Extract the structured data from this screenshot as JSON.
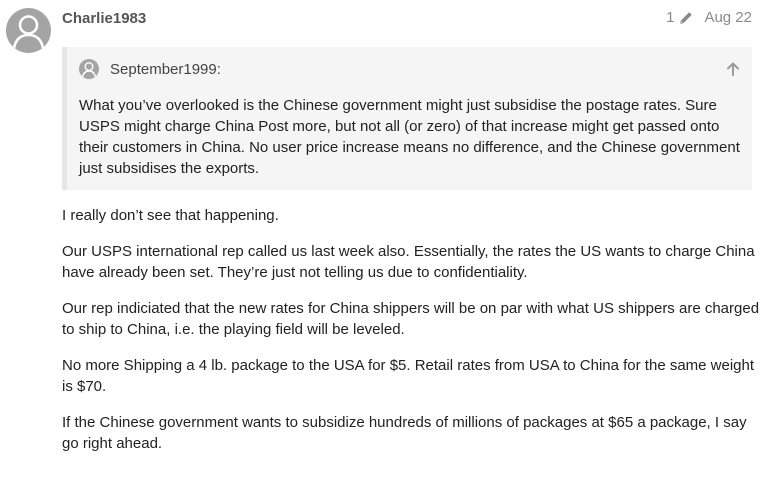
{
  "post": {
    "username": "Charlie1983",
    "avatar_icon": "default-user-avatar-icon",
    "edit_count": "1",
    "edit_icon": "pencil-icon",
    "date": "Aug 22"
  },
  "quote": {
    "author": "September1999:",
    "avatar_icon": "default-user-avatar-icon",
    "jump_icon": "arrow-up-icon",
    "text": "What you’ve overlooked is the Chinese government might just subsidise the postage rates. Sure USPS might charge China Post more, but not all (or zero) of that increase might get passed onto their customers in China. No user price increase means no difference, and the Chinese government just subsidises the exports."
  },
  "body": {
    "paragraphs": [
      "I really don’t see that happening.",
      "Our USPS international rep called us last week also. Essentially, the rates the US wants to charge China have already been set. They’re just not telling us due to confidentiality.",
      "Our rep indiciated that the new rates for China shippers will be on par with what US shippers are charged to ship to China, i.e. the playing field will be leveled.",
      "No more Shipping a 4 lb. package to the USA for $5. Retail rates from USA to China for the same weight is $70.",
      "If the Chinese government wants to subsidize hundreds of millions of packages at $65 a package, I say go right ahead."
    ]
  },
  "colors": {
    "avatar_bg": "#a4a4a4",
    "quote_bg": "#f5f5f5",
    "quote_border": "#e6e6e6",
    "meta_text": "#8a8a8a"
  }
}
